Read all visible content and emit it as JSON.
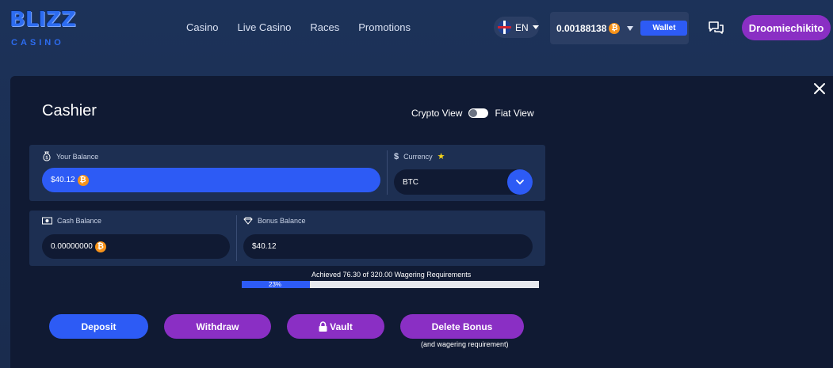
{
  "header": {
    "logo_top": "BLIZZ",
    "logo_bottom": "CASINO",
    "nav": [
      "Casino",
      "Live Casino",
      "Races",
      "Promotions"
    ],
    "language": "EN",
    "wallet_balance": "0.00188138",
    "wallet_button": "Wallet",
    "username": "Droomiechikito"
  },
  "cashier": {
    "title": "Cashier",
    "crypto_view_label": "Crypto View",
    "fiat_view_label": "Fiat View",
    "your_balance_label": "Your Balance",
    "your_balance_value": "$40.12",
    "currency_label": "Currency",
    "currency_value": "BTC",
    "cash_balance_label": "Cash Balance",
    "cash_balance_value": "0.00000000",
    "bonus_balance_label": "Bonus Balance",
    "bonus_balance_value": "$40.12",
    "wagering_text": "Achieved 76.30 of 320.00 Wagering Requirements",
    "wagering_percent_label": "23%",
    "wagering_fraction": 0.23,
    "deposit_label": "Deposit",
    "withdraw_label": "Withdraw",
    "vault_label": "Vault",
    "delete_bonus_label": "Delete Bonus",
    "delete_bonus_note": "(and wagering requirement)"
  },
  "colors": {
    "accent_blue": "#2d5bf5",
    "purple": "#8a2fc4",
    "btc_orange": "#f7931a",
    "modal_bg": "#101a33",
    "panel_bg": "#1d2f52"
  },
  "icons": [
    "money-bag-icon",
    "dollar-icon",
    "star-icon",
    "cash-icon",
    "diamond-icon",
    "lock-icon",
    "chat-icon",
    "close-icon",
    "chevron-down-icon",
    "bitcoin-icon",
    "uk-flag-icon"
  ]
}
